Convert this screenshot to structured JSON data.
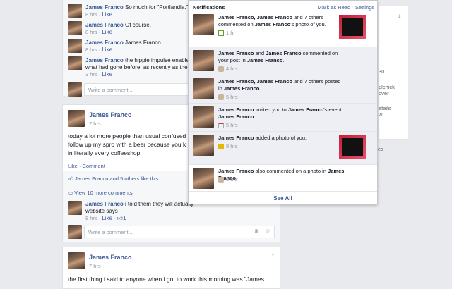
{
  "top_card": {
    "comments": [
      {
        "author": "James Franco",
        "text": "So much for \"Portlandia.\"",
        "time": "8 hrs",
        "like": "Like"
      },
      {
        "author": "James Franco",
        "text": "Of course.",
        "time": "8 hrs",
        "like": "Like"
      },
      {
        "author": "James Franco",
        "text": "James Franco.",
        "time": "8 hrs",
        "like": "Like"
      },
      {
        "author": "James Franco",
        "text": "the hippie impulse enabled c",
        "text2": "what had gone before, as recently as the ea",
        "time": "3 hrs",
        "like": "Like"
      }
    ],
    "write_placeholder": "Write a comment..."
  },
  "post2": {
    "author": "James Franco",
    "time": "7 hrs",
    "body": [
      "today a lot more people than usual confused",
      "follow up my spro with a beer because you k",
      "in literally every coffeeshop"
    ],
    "actions": "Like · Comment",
    "likes": "James Franco and 5 others like this.",
    "view_more": "View 10 more comments",
    "comment": {
      "author": "James Franco",
      "text": "i told them they will actually",
      "text2": "website says",
      "time": "8 hrs",
      "like": "Like",
      "like_count": "1"
    },
    "write_placeholder": "Write a comment..."
  },
  "post3": {
    "author": "James Franco",
    "time": "7 hrs",
    "body": "the first thing i said to anyone when i got to work this morning was \"James"
  },
  "notifications": {
    "title": "Notifications",
    "mark_read": "Mark as Read",
    "settings": "Settings",
    "see_all": "See All",
    "items": [
      {
        "parts": [
          [
            "b",
            "James Franco, James Franco"
          ],
          [
            "t",
            " and 7 others commented on "
          ],
          [
            "b",
            "James Franco"
          ],
          [
            "t",
            "'s photo of you."
          ]
        ],
        "time": "1 hr",
        "icon": "comment-icon",
        "thumb": true,
        "unread": false
      },
      {
        "parts": [
          [
            "b",
            "James Franco"
          ],
          [
            "t",
            " and "
          ],
          [
            "b",
            "James Franco"
          ],
          [
            "t",
            " commented on your post in "
          ],
          [
            "b",
            "James Franco"
          ],
          [
            "t",
            "."
          ]
        ],
        "time": "4 hrs",
        "icon": "group-icon",
        "thumb": false,
        "unread": true
      },
      {
        "parts": [
          [
            "b",
            "James Franco, James Franco"
          ],
          [
            "t",
            " and 7 others posted in "
          ],
          [
            "b",
            "James Franco"
          ],
          [
            "t",
            "."
          ]
        ],
        "time": "5 hrs",
        "icon": "group-icon",
        "thumb": false,
        "unread": true
      },
      {
        "parts": [
          [
            "b",
            "James Franco"
          ],
          [
            "t",
            " invited you to "
          ],
          [
            "b",
            "James Franco"
          ],
          [
            "t",
            "'s event "
          ],
          [
            "b",
            "James Franco"
          ],
          [
            "t",
            "."
          ]
        ],
        "time": "5 hrs",
        "icon": "calendar-icon",
        "thumb": false,
        "unread": true
      },
      {
        "parts": [
          [
            "b",
            "James Franco"
          ],
          [
            "t",
            " added a photo of you."
          ]
        ],
        "time": "8 hrs",
        "icon": "photo-icon",
        "thumb": true,
        "unread": true
      },
      {
        "parts": [
          [
            "b",
            "James Franco"
          ],
          [
            "t",
            " also commented on a photo in "
          ],
          [
            "b",
            "James Franco"
          ],
          [
            "t",
            "."
          ]
        ],
        "time": "8 hrs",
        "icon": "group-icon",
        "thumb": false,
        "unread": false
      }
    ]
  },
  "right_panel": {
    "snips": [
      "30",
      "plchick",
      "over",
      "etails",
      "w",
      "es ·"
    ]
  }
}
